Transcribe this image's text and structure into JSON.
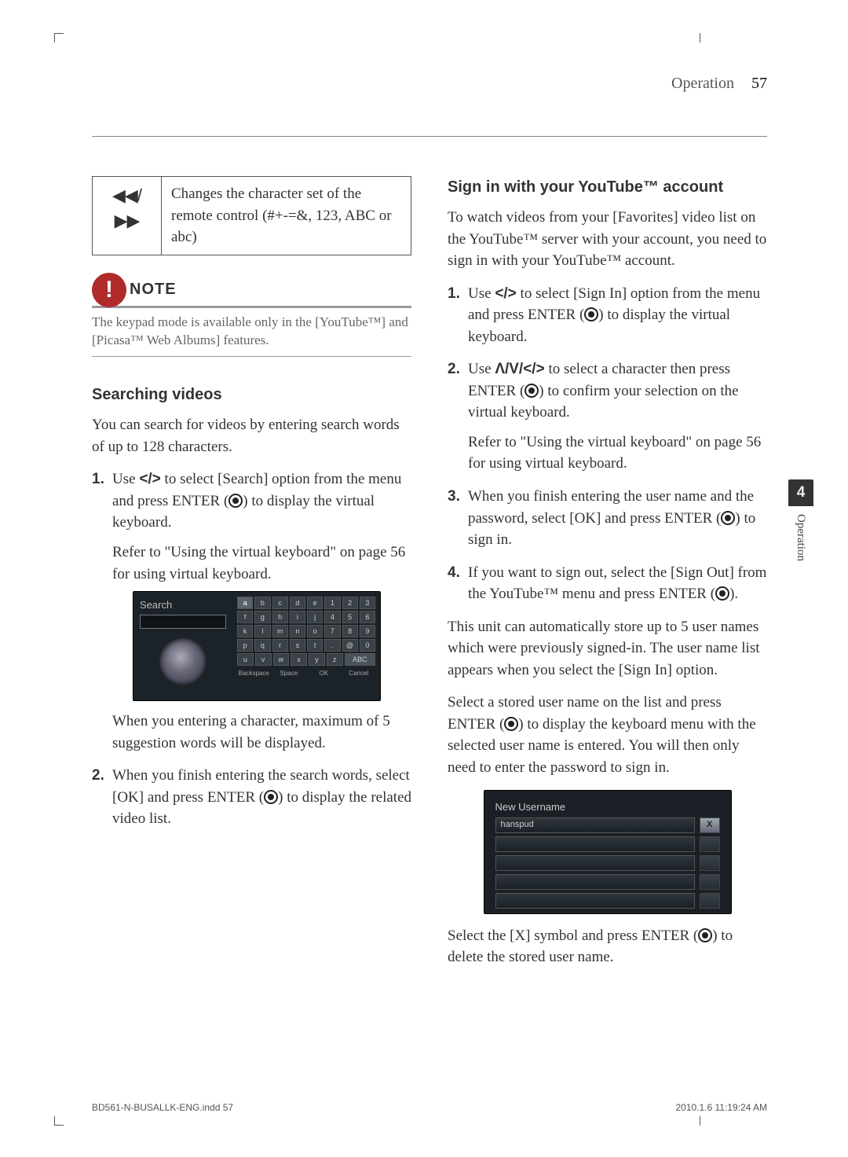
{
  "header": {
    "section": "Operation",
    "page_number": "57"
  },
  "left": {
    "table_icon": "◀◀/▶▶",
    "table_text": "Changes the character set of the remote control (#+-=&, 123, ABC or abc)",
    "note_title": "NOTE",
    "note_body": "The keypad mode is available only in the [YouTube™] and [Picasa™ Web Albums] features.",
    "h_search": "Searching videos",
    "p_search_intro": "You can search for videos by entering search words of up to 128 characters.",
    "li1_a": "Use ",
    "li1_arrows": "</>",
    "li1_b": " to select [Search] option from the menu and press ENTER (",
    "li1_c": ") to display the virtual keyboard.",
    "li1_ref": "Refer to \"Using the virtual keyboard\" on page 56 for using virtual keyboard.",
    "ss_search_label": "Search",
    "kb": {
      "r1": [
        "a",
        "b",
        "c",
        "d",
        "e",
        "1",
        "2",
        "3"
      ],
      "r2": [
        "f",
        "g",
        "h",
        "i",
        "j",
        "4",
        "5",
        "6"
      ],
      "r3": [
        "k",
        "l",
        "m",
        "n",
        "o",
        "7",
        "8",
        "9"
      ],
      "r4": [
        "p",
        "q",
        "r",
        "s",
        "t",
        ".",
        "@",
        "0"
      ],
      "r5": [
        "u",
        "v",
        "w",
        "x",
        "y",
        "z",
        "ABC",
        ""
      ],
      "bottom": [
        "Backspace",
        "Space",
        "OK",
        "Cancel"
      ]
    },
    "caption": "When you entering a character, maximum of 5 suggestion words will be displayed.",
    "li2_a": "When you finish entering the search words, select [OK] and press ENTER (",
    "li2_b": ") to display the related video list."
  },
  "right": {
    "h_signin": "Sign in with your YouTube™ account",
    "p_signin_intro": "To watch videos from your [Favorites] video list on the YouTube™ server with your account, you need to sign in with your YouTube™ account.",
    "li1_a": "Use ",
    "li1_arrows": "</>",
    "li1_b": " to select [Sign In] option from the menu and press ENTER (",
    "li1_c": ") to display the virtual keyboard.",
    "li2_a": "Use ",
    "li2_arrows": "Λ/V/</>",
    "li2_b": " to select a character then press ENTER (",
    "li2_c": ") to confirm your selection on the virtual keyboard.",
    "li2_ref": "Refer to \"Using the virtual keyboard\" on page 56 for using virtual keyboard.",
    "li3_a": "When you finish entering the user name and the password, select [OK] and press ENTER (",
    "li3_b": ") to sign in.",
    "li4_a": "If you want to sign out, select the [Sign Out] from the YouTube™ menu and press ENTER (",
    "li4_b": ").",
    "p_auto": "This unit can automatically store up to 5 user names which were previously signed-in. The user name list appears when you select the [Sign In] option.",
    "p_stored": "Select a stored user name on the list and press ENTER (",
    "p_stored_b": ") to display the keyboard menu with the selected user name is entered. You will then only need to enter the password to sign in.",
    "us_title": "New Username",
    "us_sample": "hanspud",
    "us_x": "X",
    "p_delete_a": "Select the [X] symbol and press ENTER (",
    "p_delete_b": ") to delete the stored user name."
  },
  "sidetab": {
    "num": "4",
    "label": "Operation"
  },
  "footer": {
    "file": "BD561-N-BUSALLK-ENG.indd   57",
    "timestamp": "2010.1.6   11:19:24 AM"
  }
}
